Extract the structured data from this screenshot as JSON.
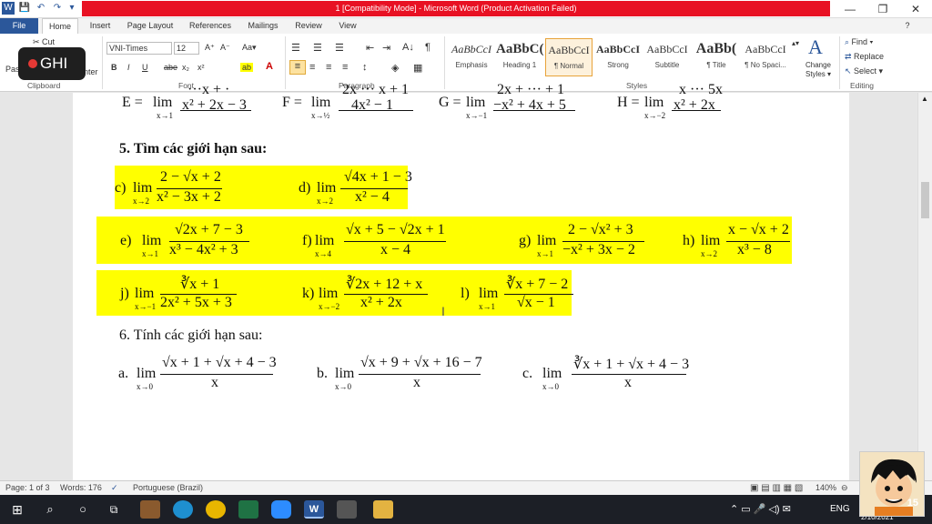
{
  "window": {
    "title": "1 [Compatibility Mode] - Microsoft Word (Product Activation Failed)",
    "min": "—",
    "restore": "❐",
    "close": "✕"
  },
  "qat": [
    "W",
    "💾",
    "↶",
    "↷",
    "▾"
  ],
  "tabs": [
    "File",
    "Home",
    "Insert",
    "Page Layout",
    "References",
    "Mailings",
    "Review",
    "View"
  ],
  "ribbon": {
    "clipboard": {
      "cut": "✂ Cut",
      "paste": "Pas",
      "painter": "nter",
      "label": "Clipboard"
    },
    "font": {
      "family": "VNI-Times",
      "size": "12",
      "label": "Font",
      "buttons": [
        "B",
        "I",
        "U",
        "abe",
        "x₂",
        "x²"
      ],
      "grow": "A⁺",
      "shrink": "A⁻",
      "case": "Aa▾"
    },
    "paragraph": {
      "label": "Paragraph",
      "symbols": [
        "☰",
        "☰",
        "☰",
        "⇤",
        "⇥",
        "A↓",
        "¶"
      ]
    },
    "styles": {
      "label": "Styles",
      "items": [
        {
          "sample": "AaBbCcI",
          "name": "Emphasis"
        },
        {
          "sample": "AaBbC(",
          "name": "Heading 1"
        },
        {
          "sample": "AaBbCcI",
          "name": "¶ Normal"
        },
        {
          "sample": "AaBbCcI",
          "name": "Strong"
        },
        {
          "sample": "AaBbCcI",
          "name": "Subtitle"
        },
        {
          "sample": "AaBb(",
          "name": "¶ Title"
        },
        {
          "sample": "AaBbCcI",
          "name": "¶ No Spaci..."
        }
      ],
      "change": "Change Styles ▾"
    },
    "editing": {
      "label": "Editing",
      "find": "Find ▾",
      "replace": "Replace",
      "select": "Select ▾"
    }
  },
  "recording": {
    "label": "GHI"
  },
  "doc": {
    "row1": {
      "E": {
        "name": "E =",
        "sub": "x→1",
        "num": "···x + ·",
        "den": "x² + 2x − 3"
      },
      "F": {
        "name": "F =",
        "sub": "x→½",
        "num": "2x ··· x + 1",
        "den": "4x² − 1"
      },
      "G": {
        "name": "G =",
        "sub": "x→−1",
        "num": "2x + ··· + 1",
        "den": "−x² + 4x + 5"
      },
      "H": {
        "name": "H =",
        "sub": "x→−2",
        "num": "x ··· 5x",
        "den": "x² + 2x"
      }
    },
    "sec5": "5.  Tìm các giới hạn sau:",
    "c": {
      "label": "c)",
      "sub": "x→2",
      "num": "2 − √x + 2",
      "den": "x² − 3x + 2"
    },
    "d": {
      "label": "d)",
      "sub": "x→2",
      "num": "√4x + 1 − 3",
      "den": "x² − 4"
    },
    "e": {
      "label": "e)",
      "sub": "x→1",
      "num": "√2x + 7 − 3",
      "den": "x³ − 4x² + 3"
    },
    "f": {
      "label": "f)",
      "sub": "x→4",
      "num": "√x + 5 − √2x + 1",
      "den": "x − 4"
    },
    "g": {
      "label": "g)",
      "sub": "x→1",
      "num": "2 − √x² + 3",
      "den": "−x² + 3x − 2"
    },
    "h": {
      "label": "h)",
      "sub": "x→2",
      "num": "x − √x + 2",
      "den": "x³ − 8"
    },
    "j": {
      "label": "j)",
      "sub": "x→−1",
      "num": "∛x + 1",
      "den": "2x² + 5x + 3"
    },
    "k": {
      "label": "k)",
      "sub": "x→−2",
      "num": "∛2x + 12 + x",
      "den": "x² + 2x"
    },
    "l": {
      "label": "l)",
      "sub": "x→1",
      "num": "∛x + 7 − 2",
      "den": "√x − 1"
    },
    "sec6": "6.  Tính các giới hạn sau:",
    "a": {
      "label": "a.",
      "sub": "x→0",
      "num": "√x + 1 + √x + 4 − 3",
      "den": "x"
    },
    "b": {
      "label": "b.",
      "sub": "x→0",
      "num": "√x + 9 + √x + 16 − 7",
      "den": "x"
    },
    "c6": {
      "label": "c.",
      "sub": "x→0",
      "num": "∛x + 1 + √x + 4 − 3",
      "den": "x"
    },
    "lim": "lim"
  },
  "status": {
    "page": "Page: 1 of 3",
    "words": "Words: 176",
    "lang": "Portuguese (Brazil)",
    "zoom": "140%"
  },
  "taskbar": {
    "lang": "ENG",
    "date": "2/10/2021"
  },
  "avatar": {
    "badge": "15"
  },
  "colors": {
    "word_blue": "#2b579a",
    "title_red": "#e81123",
    "highlight": "#ffff00"
  }
}
